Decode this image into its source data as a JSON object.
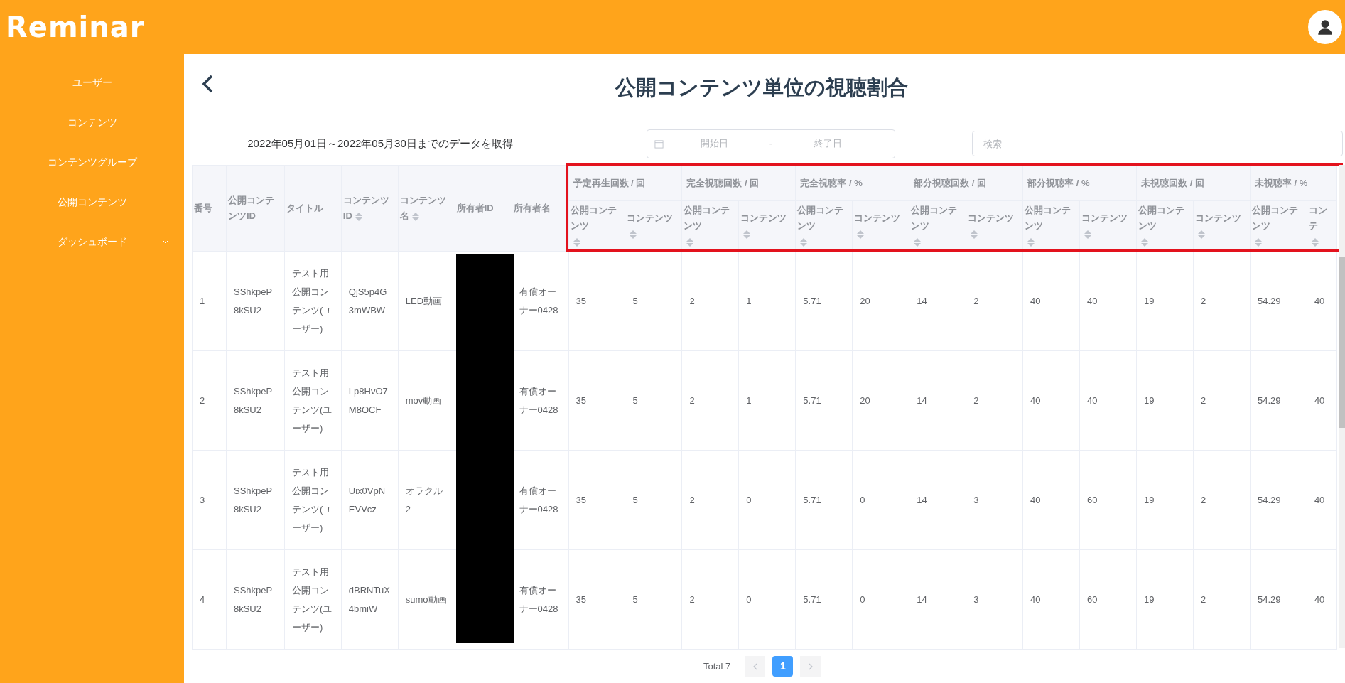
{
  "header": {
    "logo": "Reminar"
  },
  "sidebar": {
    "items": [
      {
        "label": "ユーザー",
        "expandable": false
      },
      {
        "label": "コンテンツ",
        "expandable": false
      },
      {
        "label": "コンテンツグループ",
        "expandable": false
      },
      {
        "label": "公開コンテンツ",
        "expandable": false
      },
      {
        "label": "ダッシュボード",
        "expandable": true
      }
    ]
  },
  "page": {
    "title": "公開コンテンツ単位の視聴割合"
  },
  "filter": {
    "range_text": "2022年05月01日～2022年05月30日までのデータを取得",
    "date_picker": {
      "start_placeholder": "開始日",
      "separator": "-",
      "end_placeholder": "終了日"
    },
    "search": {
      "placeholder": "検索"
    }
  },
  "table": {
    "highlight_groups": true,
    "columns": [
      {
        "label": "番号",
        "sortable": false,
        "kind": "text"
      },
      {
        "label": "公開コンテンツID",
        "sortable": false,
        "kind": "text"
      },
      {
        "label": "タイトル",
        "sortable": false,
        "kind": "text"
      },
      {
        "label": "コンテンツID",
        "sortable": true,
        "kind": "text"
      },
      {
        "label": "コンテンツ名",
        "sortable": true,
        "kind": "text"
      },
      {
        "label": "所有者ID",
        "sortable": false,
        "kind": "redacted"
      },
      {
        "label": "所有者名",
        "sortable": false,
        "kind": "text"
      }
    ],
    "column_groups": [
      {
        "label": "予定再生回数 / 回",
        "subcolumns": [
          {
            "label": "公開コンテンツ",
            "sortable": true
          },
          {
            "label": "コンテンツ",
            "sortable": true
          }
        ]
      },
      {
        "label": "完全視聴回数 / 回",
        "subcolumns": [
          {
            "label": "公開コンテンツ",
            "sortable": true
          },
          {
            "label": "コンテンツ",
            "sortable": true
          }
        ]
      },
      {
        "label": "完全視聴率 / %",
        "subcolumns": [
          {
            "label": "公開コンテンツ",
            "sortable": true
          },
          {
            "label": "コンテンツ",
            "sortable": true
          }
        ]
      },
      {
        "label": "部分視聴回数 / 回",
        "subcolumns": [
          {
            "label": "公開コンテンツ",
            "sortable": true
          },
          {
            "label": "コンテンツ",
            "sortable": true
          }
        ]
      },
      {
        "label": "部分視聴率 / %",
        "subcolumns": [
          {
            "label": "公開コンテンツ",
            "sortable": true
          },
          {
            "label": "コンテンツ",
            "sortable": true
          }
        ]
      },
      {
        "label": "未視聴回数 / 回",
        "subcolumns": [
          {
            "label": "公開コンテンツ",
            "sortable": true
          },
          {
            "label": "コンテンツ",
            "sortable": true
          }
        ]
      },
      {
        "label": "未視聴率 / %",
        "subcolumns": [
          {
            "label": "公開コンテンツ",
            "sortable": true
          },
          {
            "label": "コンテ",
            "sortable": true
          }
        ]
      }
    ],
    "rows": [
      {
        "values": [
          "1",
          "SShkpeP8kSU2",
          "テスト用公開コンテンツ(ユーザー)",
          "QjS5p4G3mWBW",
          "LED動画",
          "有償オーナー0428",
          "35",
          "5",
          "2",
          "1",
          "5.71",
          "20",
          "14",
          "2",
          "40",
          "40",
          "19",
          "2",
          "54.29",
          "40"
        ]
      },
      {
        "values": [
          "2",
          "SShkpeP8kSU2",
          "テスト用公開コンテンツ(ユーザー)",
          "Lp8HvO7M8OCF",
          "mov動画",
          "有償オーナー0428",
          "35",
          "5",
          "2",
          "1",
          "5.71",
          "20",
          "14",
          "2",
          "40",
          "40",
          "19",
          "2",
          "54.29",
          "40"
        ]
      },
      {
        "values": [
          "3",
          "SShkpeP8kSU2",
          "テスト用公開コンテンツ(ユーザー)",
          "Uix0VpNEVVcz",
          "オラクル2",
          "有償オーナー0428",
          "35",
          "5",
          "2",
          "0",
          "5.71",
          "0",
          "14",
          "3",
          "40",
          "60",
          "19",
          "2",
          "54.29",
          "40"
        ]
      },
      {
        "values": [
          "4",
          "SShkpeP8kSU2",
          "テスト用公開コンテンツ(ユーザー)",
          "dBRNTuX4bmiW",
          "sumo動画",
          "有償オーナー0428",
          "35",
          "5",
          "2",
          "0",
          "5.71",
          "0",
          "14",
          "3",
          "40",
          "60",
          "19",
          "2",
          "54.29",
          "40"
        ]
      }
    ]
  },
  "pagination": {
    "total": "Total 7",
    "prev_disabled": true,
    "next_disabled": true,
    "pages": [
      {
        "label": "1",
        "selected": true
      }
    ]
  }
}
